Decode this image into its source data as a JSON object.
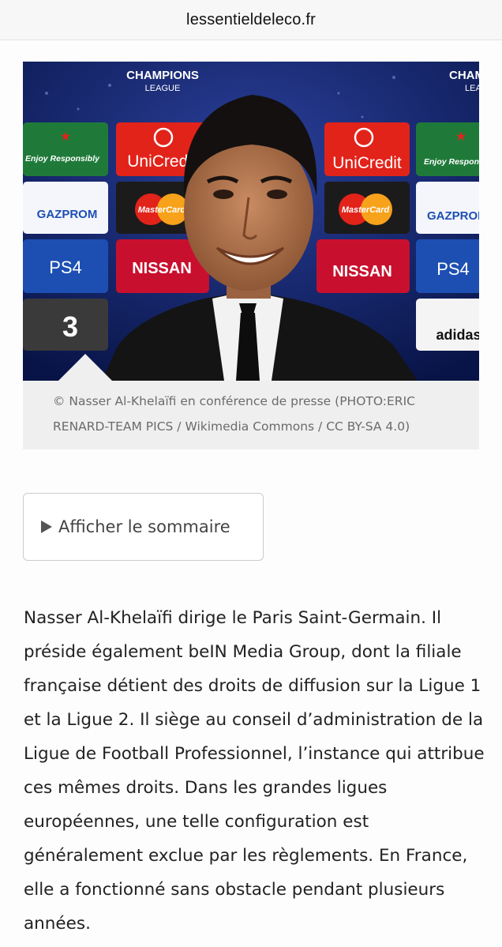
{
  "browser": {
    "url": "lessentieldeleco.fr"
  },
  "figure": {
    "caption": "© Nasser Al-Khelaïfi en conférence de presse (PHOTO:ERIC RENARD-TEAM PICS / Wikimedia Commons / CC BY-SA 4.0)",
    "backdrop_logos": {
      "champions_line1": "CHAMPIONS",
      "champions_line2": "LEAGUE",
      "heineken": "Enjoy Responsibly",
      "unicredit": "UniCredit",
      "gazprom": "GAZPROM",
      "mastercard": "MasterCard",
      "ps4": "PS4",
      "nissan": "NISSAN",
      "tv3": "3",
      "adidas": "adidas"
    }
  },
  "toc": {
    "label": "Afficher le sommaire"
  },
  "article": {
    "paragraph": "Nasser Al-Khelaïfi dirige le Paris Saint-Germain. Il préside également beIN Media Group, dont la filiale française détient des droits de diffusion sur la Ligue 1 et la Ligue 2. Il siège au conseil d’administration de la Ligue de Football Professionnel, l’instance qui attribue ces mêmes droits. Dans les grandes ligues européennes, une telle configuration est généralement exclue par les règlements. En France, elle a fonctionné sans obstacle pendant plusieurs années."
  },
  "colors": {
    "backdrop_blue": "#0c1a5c",
    "heineken_green": "#1f7a3a",
    "unicredit_red": "#e2231a",
    "nissan_red": "#c8102e",
    "ps4_blue": "#1d4fb3",
    "gazprom_white": "#f4f6fb"
  }
}
